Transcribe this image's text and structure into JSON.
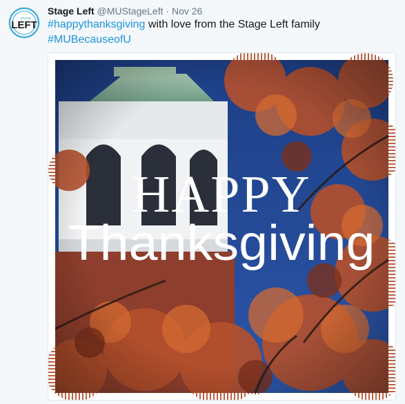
{
  "tweet": {
    "author_name": "Stage Left",
    "author_handle": "@MUStageLeft",
    "separator": "·",
    "date": "Nov 26",
    "text_hashtag_1": "#happythanksgiving",
    "text_body": " with love from the Stage Left family",
    "text_hashtag_2": "#MUBecauseofU"
  },
  "avatar": {
    "logo_text": "LEFT",
    "logo_small_text": "STAGE"
  },
  "media": {
    "line1": "HAPPY",
    "line2": "Thanksgiving"
  },
  "colors": {
    "hashtag": "#1b95e0",
    "name": "#14171a",
    "meta": "#657786",
    "logo_blue": "#2aa3d8"
  }
}
